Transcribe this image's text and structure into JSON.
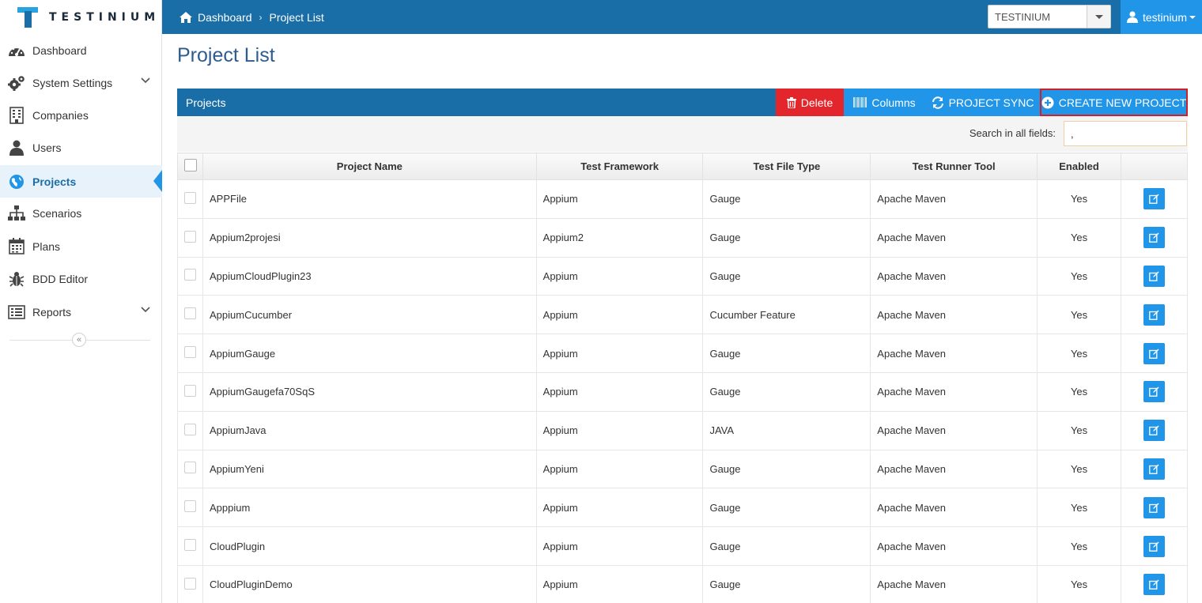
{
  "app": {
    "logo_text": "TESTINIUM"
  },
  "breadcrumb": {
    "home": "Dashboard",
    "current": "Project List"
  },
  "company_select": {
    "value": "TESTINIUM"
  },
  "user": {
    "name": "testinium"
  },
  "sidebar": {
    "items": [
      {
        "label": "Dashboard",
        "icon": "dashboard-icon"
      },
      {
        "label": "System Settings",
        "icon": "gears-icon",
        "expandable": true
      },
      {
        "label": "Companies",
        "icon": "building-icon"
      },
      {
        "label": "Users",
        "icon": "user-icon"
      },
      {
        "label": "Projects",
        "icon": "globe-icon",
        "active": true
      },
      {
        "label": "Scenarios",
        "icon": "sitemap-icon"
      },
      {
        "label": "Plans",
        "icon": "calendar-icon"
      },
      {
        "label": "BDD Editor",
        "icon": "bug-icon"
      },
      {
        "label": "Reports",
        "icon": "list-icon",
        "expandable": true
      }
    ],
    "collapse_glyph": "«"
  },
  "page": {
    "title": "Project List"
  },
  "panel": {
    "title": "Projects",
    "delete_label": "Delete",
    "columns_label": "Columns",
    "sync_label": "PROJECT SYNC",
    "create_label": "CREATE NEW PROJECT"
  },
  "search": {
    "label": "Search in all fields:",
    "value": ","
  },
  "table": {
    "columns": [
      "Project Name",
      "Test Framework",
      "Test File Type",
      "Test Runner Tool",
      "Enabled"
    ],
    "rows": [
      [
        "APPFile",
        "Appium",
        "Gauge",
        "Apache Maven",
        "Yes"
      ],
      [
        "Appium2projesi",
        "Appium2",
        "Gauge",
        "Apache Maven",
        "Yes"
      ],
      [
        "AppiumCloudPlugin23",
        "Appium",
        "Gauge",
        "Apache Maven",
        "Yes"
      ],
      [
        "AppiumCucumber",
        "Appium",
        "Cucumber Feature",
        "Apache Maven",
        "Yes"
      ],
      [
        "AppiumGauge",
        "Appium",
        "Gauge",
        "Apache Maven",
        "Yes"
      ],
      [
        "AppiumGaugefa70SqS",
        "Appium",
        "Gauge",
        "Apache Maven",
        "Yes"
      ],
      [
        "AppiumJava",
        "Appium",
        "JAVA",
        "Apache Maven",
        "Yes"
      ],
      [
        "AppiumYeni",
        "Appium",
        "Gauge",
        "Apache Maven",
        "Yes"
      ],
      [
        "Apppium",
        "Appium",
        "Gauge",
        "Apache Maven",
        "Yes"
      ],
      [
        "CloudPlugin",
        "Appium",
        "Gauge",
        "Apache Maven",
        "Yes"
      ],
      [
        "CloudPluginDemo",
        "Appium",
        "Gauge",
        "Apache Maven",
        "Yes"
      ]
    ]
  },
  "colors": {
    "topbar": "#1a6ea8",
    "accent": "#2196e8",
    "danger": "#e3262b",
    "title": "#2d5d8f"
  }
}
